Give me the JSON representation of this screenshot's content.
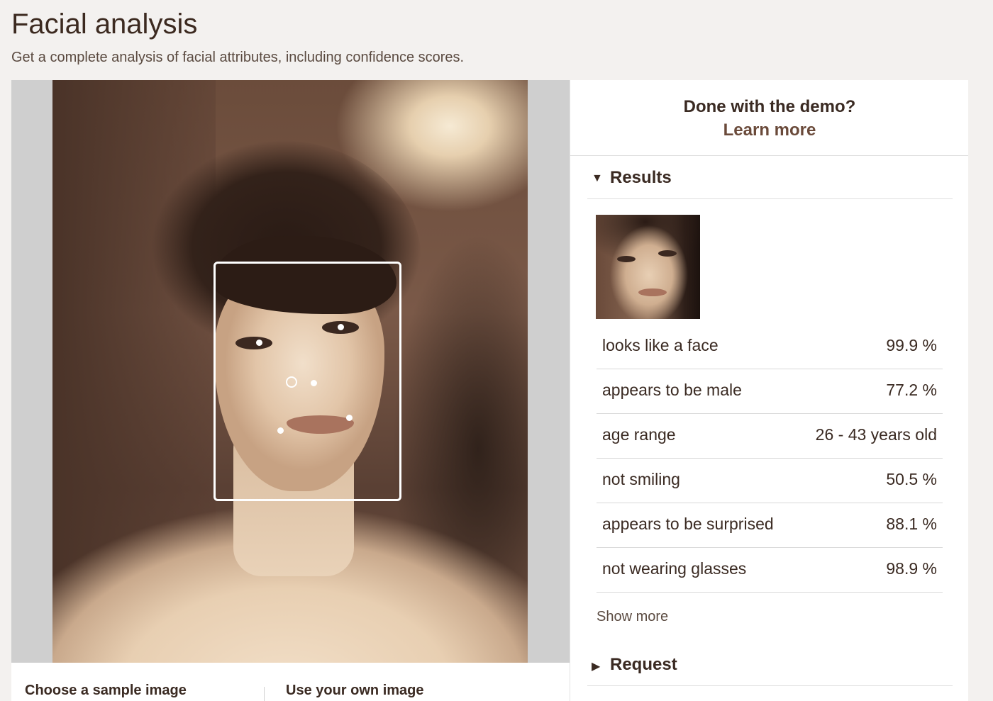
{
  "header": {
    "title": "Facial analysis",
    "subtitle": "Get a complete analysis of facial attributes, including confidence scores."
  },
  "image_tabs": {
    "sample_label": "Choose a sample image",
    "own_label": "Use your own image"
  },
  "sidebar": {
    "demo_question": "Done with the demo?",
    "demo_link": "Learn more",
    "results_label": "Results",
    "request_label": "Request",
    "show_more_label": "Show more",
    "results": [
      {
        "label": "looks like a face",
        "value": "99.9 %"
      },
      {
        "label": "appears to be male",
        "value": "77.2 %"
      },
      {
        "label": "age range",
        "value": "26 - 43 years old"
      },
      {
        "label": "not smiling",
        "value": "50.5 %"
      },
      {
        "label": "appears to be surprised",
        "value": "88.1 %"
      },
      {
        "label": "not wearing glasses",
        "value": "98.9 %"
      }
    ]
  },
  "icons": {
    "expanded": "caret-down-icon",
    "collapsed": "caret-right-icon"
  }
}
